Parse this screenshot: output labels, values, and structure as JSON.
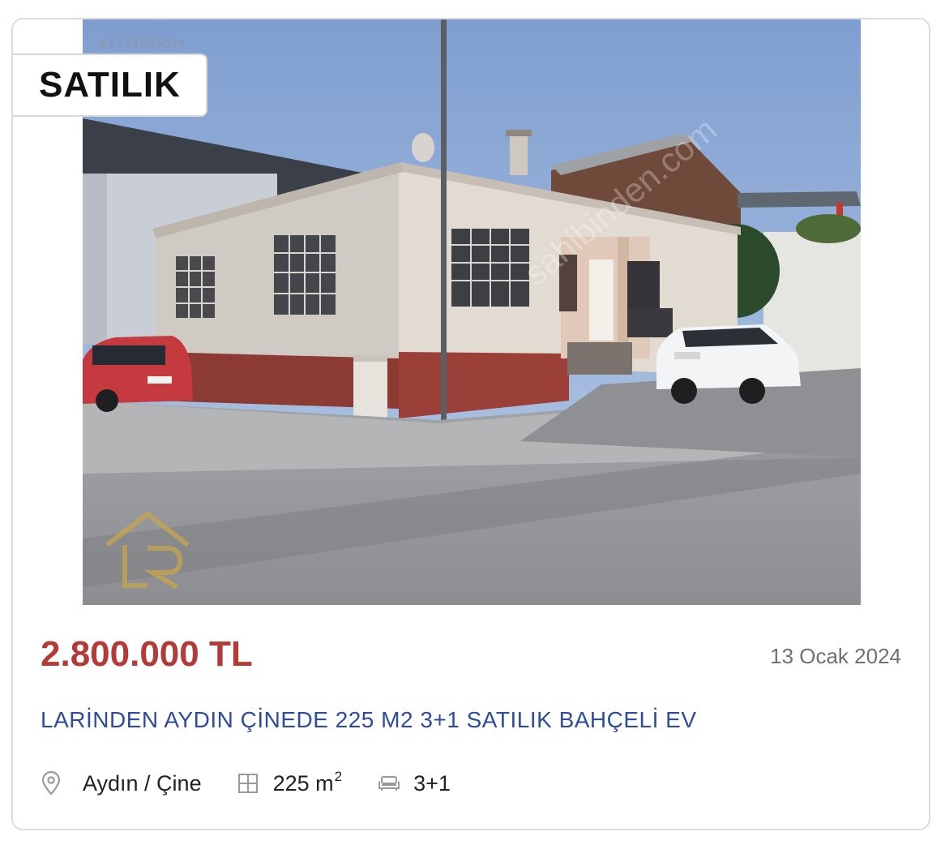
{
  "listing": {
    "id": "#1124505524",
    "status_badge": "SATILIK",
    "price": "2.800.000 TL",
    "date": "13 Ocak 2024",
    "title": "LARİNDEN AYDIN ÇİNEDE 225 M2 3+1 SATILIK BAHÇELİ EV",
    "location": "Aydın / Çine",
    "area_value": "225 m",
    "area_unit_sup": "2",
    "rooms": "3+1"
  },
  "icons": {
    "location": "map-pin-icon",
    "area": "floor-plan-icon",
    "rooms": "sofa-icon"
  },
  "colors": {
    "price": "#b23a37",
    "title": "#2f4c9c",
    "date": "#707070",
    "icon": "#9a9a9a"
  }
}
